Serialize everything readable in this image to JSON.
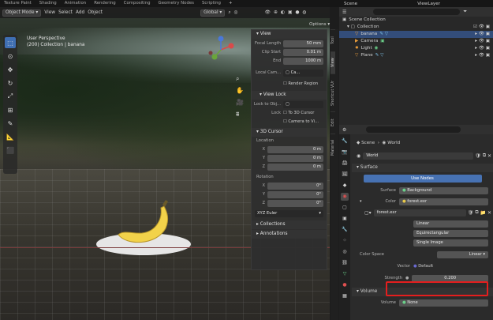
{
  "workspace_tabs": [
    "Texture Paint",
    "Shading",
    "Animation",
    "Rendering",
    "Compositing",
    "Geometry Nodes",
    "Scripting",
    "+"
  ],
  "viewport": {
    "mode": "Object Mode",
    "menu": [
      "View",
      "Select",
      "Add",
      "Object"
    ],
    "transform_orientation": "Global",
    "overlay_text": [
      "User Perspective",
      "(200) Collection | banana"
    ],
    "options": "Options"
  },
  "npanel": {
    "view_header": "View",
    "focal_label": "Focal Length",
    "focal_value": "50 mm",
    "clip_start_label": "Clip Start",
    "clip_start_value": "0.01 m",
    "end_label": "End",
    "end_value": "1000 m",
    "local_camera_label": "Local Cam...",
    "local_camera_value": "Ca...",
    "render_region": "Render Region",
    "view_lock_header": "View Lock",
    "lock_obj_label": "Lock to Obj...",
    "lock_label": "Lock",
    "lock_3d_cursor": "To 3D Cursor",
    "camera_to_view": "Camera to Vi...",
    "cursor_header": "3D Cursor",
    "location_label": "Location",
    "x": "X",
    "y": "Y",
    "z": "Z",
    "loc_x": "0 m",
    "loc_y": "0 m",
    "loc_z": "0 m",
    "rotation_label": "Rotation",
    "rot_x": "0°",
    "rot_y": "0°",
    "rot_z": "0°",
    "rotation_mode": "XYZ Euler",
    "collections": "Collections",
    "annotations": "Annotations",
    "side_tabs": [
      "Tool",
      "View",
      "Shortcut VUr",
      "Edit",
      "Material"
    ]
  },
  "outliner": {
    "scene": "Scene",
    "viewlayer": "ViewLayer",
    "items": [
      {
        "label": "Scene Collection",
        "level": 0
      },
      {
        "label": "Collection",
        "level": 1
      },
      {
        "label": "banana",
        "level": 2
      },
      {
        "label": "Camera",
        "level": 2
      },
      {
        "label": "Light",
        "level": 2
      },
      {
        "label": "Plane",
        "level": 2
      }
    ]
  },
  "properties": {
    "breadcrumb_scene": "Scene",
    "breadcrumb_world": "World",
    "world_name": "World",
    "surface_header": "Surface",
    "use_nodes": "Use Nodes",
    "surface_label": "Surface",
    "surface_value": "Background",
    "color_label": "Color",
    "color_value": "forest.exr",
    "image_name": "forest.exr",
    "interp": "Linear",
    "projection": "Equirectangular",
    "source": "Single Image",
    "color_space_label": "Color Space",
    "color_space_value": "Linear",
    "vector_label": "Vector",
    "vector_value": "Default",
    "strength_label": "Strength",
    "strength_value": "0.200",
    "volume_header": "Volume",
    "volume_label": "Volume",
    "volume_value": "None"
  }
}
